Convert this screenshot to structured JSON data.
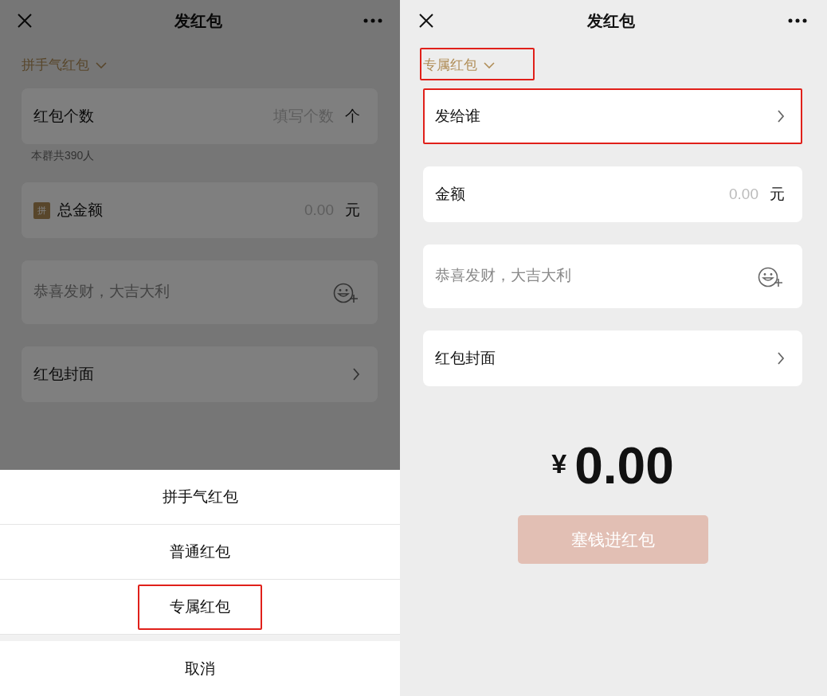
{
  "screens": [
    {
      "title": "发红包",
      "type_selector": {
        "label": "拼手气红包",
        "highlighted": false
      },
      "rows": [
        {
          "kind": "count",
          "label": "红包个数",
          "placeholder": "填写个数",
          "unit": "个",
          "note": "本群共390人",
          "highlighted": false
        },
        {
          "kind": "amount",
          "badge": "拼",
          "label": "总金额",
          "placeholder": "0.00",
          "unit": "元",
          "highlighted": false
        },
        {
          "kind": "greeting",
          "placeholder": "恭喜发财，大吉大利",
          "highlighted": false
        },
        {
          "kind": "link",
          "label": "红包封面",
          "highlighted": false
        }
      ],
      "sheet": {
        "options": [
          {
            "label": "拼手气红包",
            "highlighted": false
          },
          {
            "label": "普通红包",
            "highlighted": false
          },
          {
            "label": "专属红包",
            "highlighted": true
          }
        ],
        "cancel": "取消"
      }
    },
    {
      "title": "发红包",
      "type_selector": {
        "label": "专属红包",
        "highlighted": true
      },
      "rows": [
        {
          "kind": "link",
          "label": "发给谁",
          "highlighted": true
        },
        {
          "kind": "amount",
          "label": "金额",
          "placeholder": "0.00",
          "unit": "元",
          "highlighted": false
        },
        {
          "kind": "greeting",
          "placeholder": "恭喜发财，大吉大利",
          "highlighted": false
        },
        {
          "kind": "link",
          "label": "红包封面",
          "highlighted": false
        }
      ],
      "total": {
        "currency": "¥",
        "value": "0.00"
      },
      "submit": {
        "label": "塞钱进红包",
        "disabled": true
      }
    }
  ]
}
